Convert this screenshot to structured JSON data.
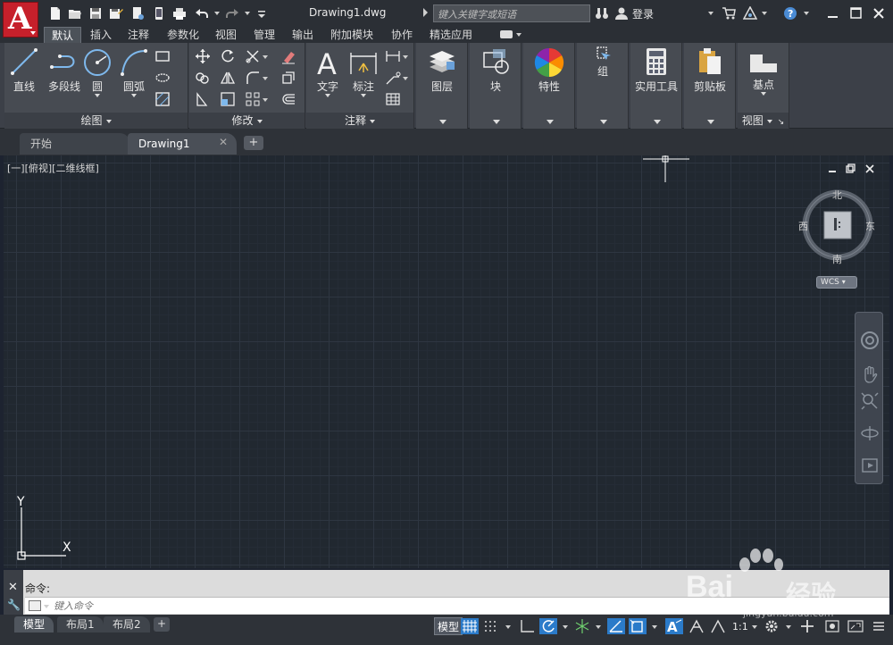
{
  "app": {
    "file_title": "Drawing1.dwg",
    "search_placeholder": "键入关键字或短语",
    "login_label": "登录"
  },
  "ribbon_tabs": [
    "默认",
    "插入",
    "注释",
    "参数化",
    "视图",
    "管理",
    "输出",
    "附加模块",
    "协作",
    "精选应用"
  ],
  "panels": {
    "draw": {
      "title": "绘图",
      "tools": [
        "直线",
        "多段线",
        "圆",
        "圆弧"
      ]
    },
    "modify": {
      "title": "修改"
    },
    "annotation": {
      "title": "注释",
      "tools": [
        "文字",
        "标注"
      ]
    },
    "layers": {
      "label": "图层"
    },
    "block": {
      "label": "块"
    },
    "properties": {
      "label": "特性"
    },
    "group": {
      "label": "组"
    },
    "utilities": {
      "label": "实用工具"
    },
    "clipboard": {
      "label": "剪贴板"
    },
    "view": {
      "title": "视图",
      "tools": [
        "基点"
      ]
    }
  },
  "file_tabs": [
    "开始",
    "Drawing1"
  ],
  "viewport": {
    "label": "[一][俯视][二维线框]",
    "compass": {
      "north": "北",
      "south": "南",
      "east": "东",
      "west": "西"
    },
    "wcs": "WCS",
    "ucs_x": "X",
    "ucs_y": "Y"
  },
  "command": {
    "history": "命令:",
    "placeholder": "键入命令"
  },
  "layout_tabs": [
    "模型",
    "布局1",
    "布局2"
  ],
  "status": {
    "model_label": "模型",
    "scale": "1:1"
  },
  "watermark": {
    "logo": "Bai",
    "logo_cn": "经验",
    "url": "jingyan.baidu.com"
  },
  "colors": {
    "accent": "#2b7bc9",
    "logo_red": "#c6202b",
    "canvas_bg": "#212830"
  }
}
